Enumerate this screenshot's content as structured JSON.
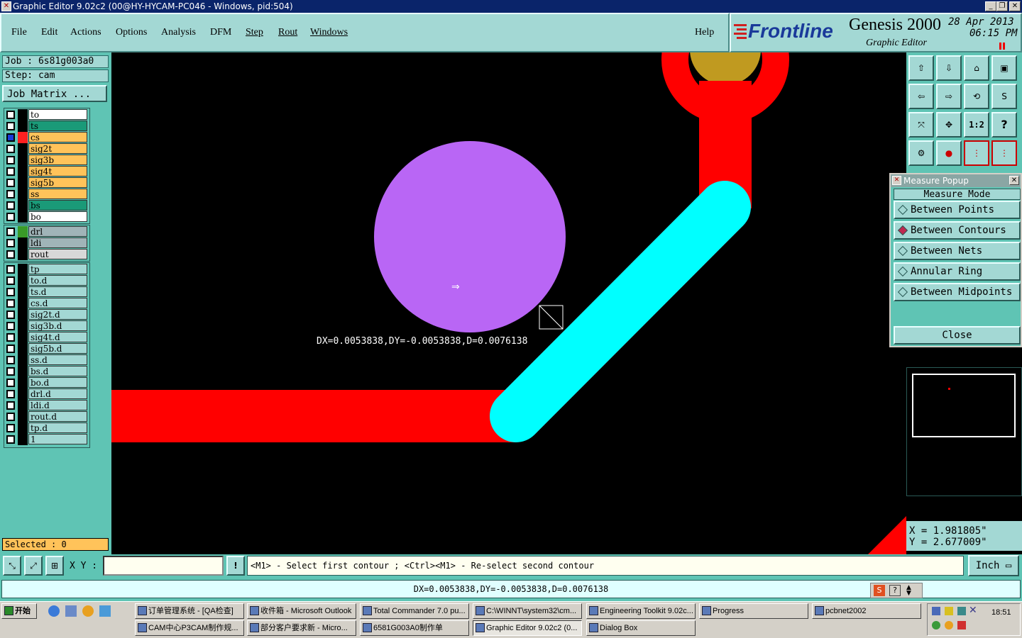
{
  "window": {
    "title": "Graphic Editor 9.02c2 (00@HY-HYCAM-PC046 - Windows, pid:504)"
  },
  "menu": {
    "items": [
      "File",
      "Edit",
      "Actions",
      "Options",
      "Analysis",
      "DFM",
      "Step",
      "Rout",
      "Windows"
    ],
    "help": "Help"
  },
  "logo": {
    "brand": "Frontline",
    "product": "Genesis 2000",
    "subtitle": "Graphic Editor",
    "date": "28 Apr 2013",
    "time": "06:15 PM"
  },
  "job": {
    "job_label": "Job : 6s81g003a0",
    "step_label": "Step: cam",
    "matrix_button": "Job Matrix ..."
  },
  "layers_board": [
    {
      "name": "to",
      "bg": "#ffffff"
    },
    {
      "name": "ts",
      "bg": "#1a9a78"
    },
    {
      "name": "cs",
      "bg": "#ffc35a",
      "active": true,
      "swatch": "#ff2020"
    },
    {
      "name": "sig2t",
      "bg": "#ffc35a"
    },
    {
      "name": "sig3b",
      "bg": "#ffc35a"
    },
    {
      "name": "sig4t",
      "bg": "#ffc35a"
    },
    {
      "name": "sig5b",
      "bg": "#ffc35a"
    },
    {
      "name": "ss",
      "bg": "#ffc35a"
    },
    {
      "name": "bs",
      "bg": "#1a9a78"
    },
    {
      "name": "bo",
      "bg": "#ffffff"
    }
  ],
  "layers_drill": [
    {
      "name": "drl",
      "bg": "#a0b4b8",
      "swatch": "#3a9a28"
    },
    {
      "name": "ldi",
      "bg": "#a0b4b8"
    },
    {
      "name": "rout",
      "bg": "#d8d8d8"
    }
  ],
  "layers_misc": [
    {
      "name": "tp"
    },
    {
      "name": "to.d"
    },
    {
      "name": "ts.d"
    },
    {
      "name": "cs.d"
    },
    {
      "name": "sig2t.d"
    },
    {
      "name": "sig3b.d"
    },
    {
      "name": "sig4t.d"
    },
    {
      "name": "sig5b.d"
    },
    {
      "name": "ss.d"
    },
    {
      "name": "bs.d"
    },
    {
      "name": "bo.d"
    },
    {
      "name": "drl.d"
    },
    {
      "name": "ldi.d"
    },
    {
      "name": "rout.d"
    },
    {
      "name": "tp.d"
    },
    {
      "name": "1"
    }
  ],
  "selected": "Selected : 0",
  "canvas": {
    "measure_text": "DX=0.0053838,DY=-0.0053838,D=0.0076138"
  },
  "toolbar_buttons": [
    "1:2",
    "?"
  ],
  "measure_popup": {
    "title": "Measure Popup",
    "mode_label": "Measure Mode",
    "options": [
      "Between Points",
      "Between Contours",
      "Between Nets",
      "Annular Ring",
      "Between Midpoints"
    ],
    "selected_option": "Between Contours",
    "close": "Close"
  },
  "coords": {
    "x": "X = 1.981805\"",
    "y": "Y = 2.677009\""
  },
  "command": {
    "xy_label": "X Y :",
    "xy_value": "",
    "excl": "!",
    "prompt": "<M1> - Select first contour ; <Ctrl><M1> - Re-select second contour",
    "units": "Inch"
  },
  "status": {
    "text": "DX=0.0053838,DY=-0.0053838,D=0.0076138"
  },
  "taskbar": {
    "start": "开始",
    "row1": [
      "订单管理系统 - [QA检查]",
      "收件箱 - Microsoft Outlook",
      "Total Commander 7.0 pu...",
      "C:\\WINNT\\system32\\cm...",
      "Engineering Toolkit 9.02c...",
      "Progress",
      "pcbnet2002"
    ],
    "row2": [
      "CAM中心P3CAM制作规...",
      "部分客户要求新 - Micro...",
      "6581G003A0制作单",
      "Graphic Editor 9.02c2 (0...",
      "Dialog Box"
    ],
    "clock": "18:51"
  }
}
